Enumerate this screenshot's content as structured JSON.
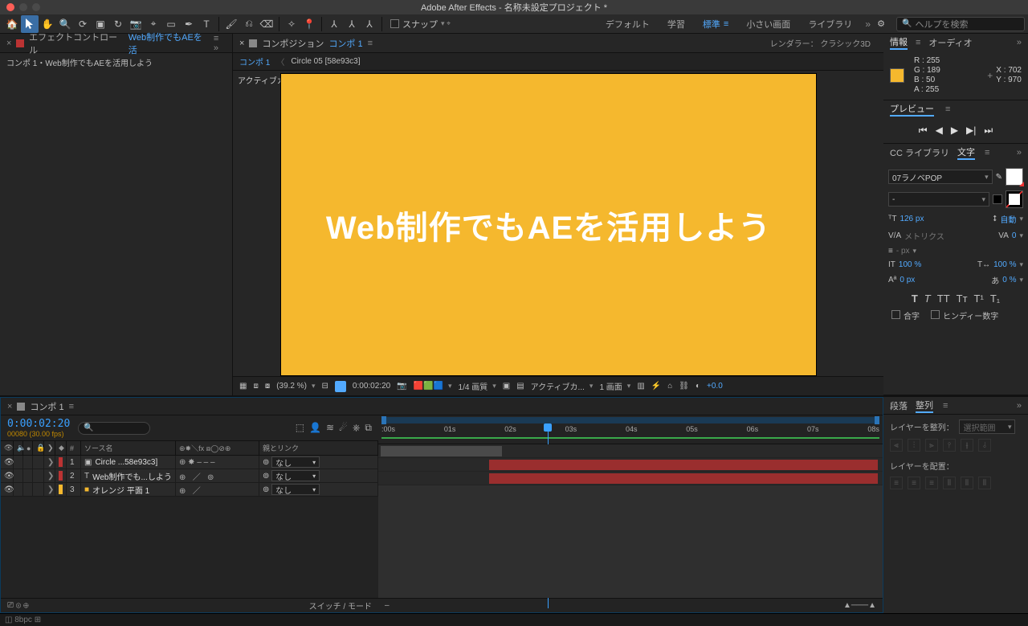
{
  "title": "Adobe After Effects - 名称未設定プロジェクト *",
  "toolbar": {
    "snap_label": "スナップ",
    "search_placeholder": "ヘルプを検索"
  },
  "workspace_tabs": [
    "デフォルト",
    "学習",
    "標準",
    "小さい画面",
    "ライブラリ"
  ],
  "workspace_active": 2,
  "effect_panel": {
    "title_prefix": "エフェクトコントロール",
    "title_link": "Web制作でもAEを活",
    "breadcrumb": "コンポ 1・Web制作でもAEを活用しよう"
  },
  "comp_panel": {
    "title_prefix": "コンポジション",
    "title_link": "コンポ 1",
    "crumb_active": "コンポ 1",
    "crumb_next": "Circle 05 [58e93c3]",
    "active_camera": "アクティブカメラ",
    "canvas_text": "Web制作でもAEを活用しよう",
    "renderer_label": "レンダラー：",
    "renderer_value": "クラシック3D"
  },
  "footer": {
    "zoom": "(39.2 %)",
    "timecode": "0:00:02:20",
    "quality": "1/4 画質",
    "camera": "アクティブカ...",
    "view": "1 画面",
    "exposure": "+0.0"
  },
  "info": {
    "tab1": "情報",
    "tab2": "オーディオ",
    "R": "255",
    "G": "189",
    "B": "50",
    "A": "255",
    "X": "702",
    "Y": "970"
  },
  "preview": {
    "title": "プレビュー"
  },
  "char": {
    "tab1": "CC ライブラリ",
    "tab2": "文字",
    "font": "07ラノベPOP",
    "style": "-",
    "size": "126 px",
    "leading": "自動",
    "tracking_label": "メトリクス",
    "tracking": "0",
    "stroke": "- px",
    "vscale": "100 %",
    "hscale": "100 %",
    "baseline": "0 px",
    "tsume": "0 %",
    "ligature": "合字",
    "hindi": "ヒンディー数字"
  },
  "timeline": {
    "tab": "コンポ 1",
    "timecode": "0:00:02:20",
    "fps": "00080 (30.00 fps)",
    "col_source": "ソース名",
    "col_parent": "親とリンク",
    "col_switches": "スイッチ / モード",
    "ticks": [
      ":00s",
      "01s",
      "02s",
      "03s",
      "04s",
      "05s",
      "06s",
      "07s",
      "08s"
    ],
    "playhead_sec": 2.67,
    "layers": [
      {
        "num": "1",
        "color": "#b33",
        "icon": "▣",
        "name": "Circle ...58e93c3]",
        "parent": "なし"
      },
      {
        "num": "2",
        "color": "#b33",
        "icon": "T",
        "name": "Web制作でも...しよう",
        "parent": "なし"
      },
      {
        "num": "3",
        "color": "#f5b82e",
        "icon": "■",
        "name": "オレンジ 平面 1",
        "parent": "なし"
      }
    ]
  },
  "align": {
    "tab1": "段落",
    "tab2": "整列",
    "align_label": "レイヤーを整列：",
    "align_value": "選択範囲",
    "distribute_label": "レイヤーを配置："
  }
}
